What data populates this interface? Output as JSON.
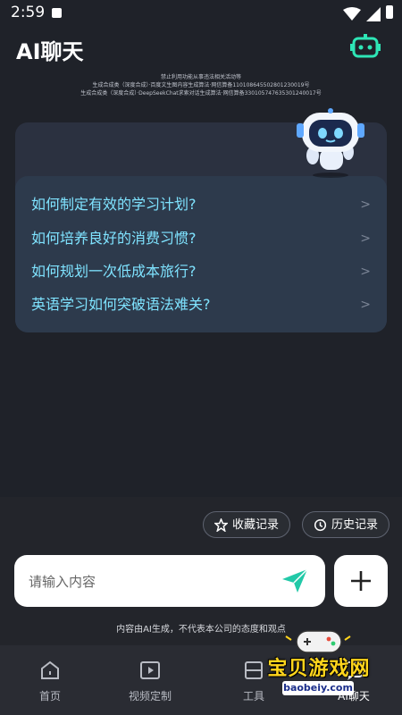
{
  "status_bar": {
    "time": "2:59"
  },
  "header": {
    "title": "AI聊天"
  },
  "notice": {
    "line1": "禁止利用功能从事违法相关活动等",
    "line2": "生成合成类（深度合成）·百度文生图内容生成算法·网信算备110108645502801230019号",
    "line3": "生成合成类（深度合成）·DeepSeekChat求索对话生成算法·网信算备330105747635301240017号"
  },
  "suggestions": [
    {
      "label": "如何制定有效的学习计划?"
    },
    {
      "label": "如何培养良好的消费习惯?"
    },
    {
      "label": "如何规划一次低成本旅行?"
    },
    {
      "label": "英语学习如何突破语法难关?"
    }
  ],
  "actions": {
    "favorites_label": "收藏记录",
    "history_label": "历史记录"
  },
  "input": {
    "placeholder": "请输入内容"
  },
  "disclaimer": "内容由AI生成，不代表本公司的态度和观点",
  "tabs": [
    {
      "label": "首页",
      "icon": "home-icon"
    },
    {
      "label": "视频定制",
      "icon": "video-icon"
    },
    {
      "label": "工具",
      "icon": "tools-icon"
    },
    {
      "label": "AI聊天",
      "icon": "chat-icon"
    }
  ],
  "watermark": {
    "text": "宝贝游戏网",
    "url": "baobeiy.com"
  },
  "colors": {
    "accent": "#7fe3ff",
    "send": "#22c9a8",
    "background": "#1f2229"
  }
}
